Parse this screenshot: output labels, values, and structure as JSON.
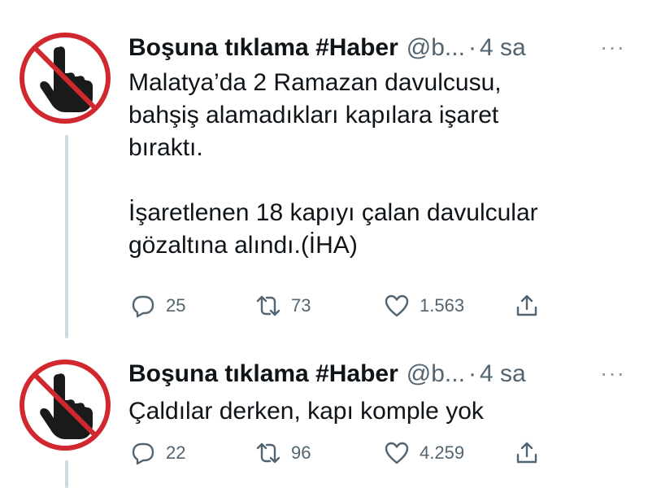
{
  "tweets": [
    {
      "name": "Boşuna tıklama #Haber",
      "handle": "@b...",
      "dot": "·",
      "time": "4 sa",
      "more": "···",
      "text": "Malatya’da 2 Ramazan davulcusu,\nbahşiş alamadıkları kapılara işaret\nbıraktı.\n\nİşaretlenen 18 kapıyı çalan davulcular\ngözaltına alındı.(İHA)",
      "replies": "25",
      "retweets": "73",
      "likes": "1.563"
    },
    {
      "name": "Boşuna tıklama #Haber",
      "handle": "@b...",
      "dot": "·",
      "time": "4 sa",
      "more": "···",
      "text": "Çaldılar derken, kapı komple yok",
      "replies": "22",
      "retweets": "96",
      "likes": "4.259"
    }
  ],
  "icons": {
    "avatar": "no-hand-pointer-icon",
    "reply": "reply-icon",
    "retweet": "retweet-icon",
    "like": "heart-icon",
    "share": "share-icon",
    "more": "more-icon"
  },
  "colors": {
    "avatar_ring": "#d0282e",
    "muted": "#536471",
    "thread_line": "#cfd9de"
  }
}
